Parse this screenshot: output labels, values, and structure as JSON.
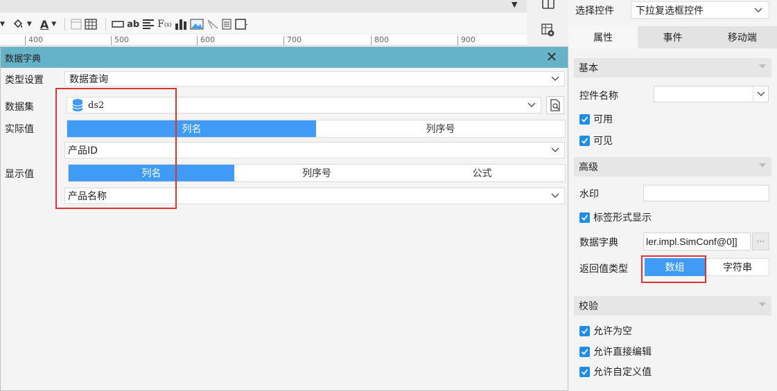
{
  "toolbar": {
    "ruler_ticks": [
      "400",
      "500",
      "600",
      "700",
      "800",
      "900"
    ],
    "text_color_glyph": "A"
  },
  "dialog": {
    "title": "数据字典",
    "type_label": "类型设置",
    "type_value": "数据查询",
    "dataset_label": "数据集",
    "dataset_value": "ds2",
    "actual_label": "实际值",
    "actual_tabs": [
      "列名",
      "列序号"
    ],
    "actual_value": "产品ID",
    "display_label": "显示值",
    "display_tabs": [
      "列名",
      "列序号",
      "公式"
    ],
    "display_value": "产品名称"
  },
  "panel": {
    "select_control_label": "选择控件",
    "select_control_value": "下拉复选框控件",
    "tabs": [
      "属性",
      "事件",
      "移动端"
    ],
    "basic_section": "基本",
    "control_name_label": "控件名称",
    "control_name_value": "",
    "enabled_label": "可用",
    "visible_label": "可见",
    "advanced_section": "高级",
    "watermark_label": "水印",
    "watermark_value": "",
    "label_display_label": "标签形式显示",
    "dict_label": "数据字典",
    "dict_value": "ler.impl.SimConf@0]]",
    "dict_more": "···",
    "return_type_label": "返回值类型",
    "return_array": "数组",
    "return_string": "字符串",
    "validation_section": "校验",
    "allow_empty_label": "允许为空",
    "allow_direct_edit_label": "允许直接编辑",
    "allow_custom_label": "允许自定义值"
  },
  "colors": {
    "accent": "#3f9bf6",
    "title_bar": "#66b2c8",
    "highlight": "#e0322f"
  }
}
